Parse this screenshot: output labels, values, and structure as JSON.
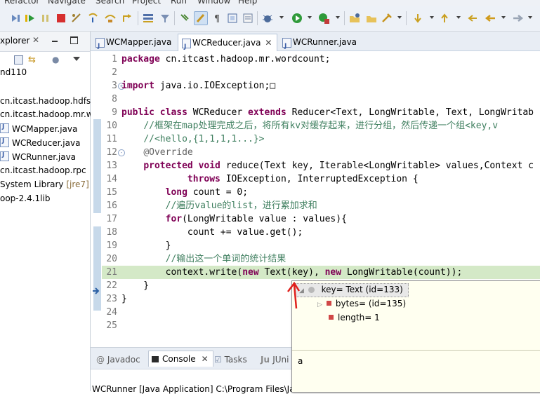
{
  "menu": [
    "Refactor",
    "Navigate",
    "Search",
    "Project",
    "Run",
    "Window",
    "Help"
  ],
  "explorer": {
    "title": "xplorer",
    "items": [
      {
        "label": "nd110",
        "kind": "project"
      },
      {
        "label": "cn.itcast.hadoop.hdfs",
        "kind": "package"
      },
      {
        "label": "cn.itcast.hadoop.mr.w",
        "kind": "package"
      },
      {
        "label": "WCMapper.java",
        "kind": "file"
      },
      {
        "label": "WCReducer.java",
        "kind": "file"
      },
      {
        "label": "WCRunner.java",
        "kind": "file"
      },
      {
        "label": "cn.itcast.hadoop.rpc",
        "kind": "package"
      },
      {
        "label": "System Library",
        "suffix": "[jre7]",
        "kind": "library"
      },
      {
        "label": "oop-2.4.1lib",
        "kind": "library"
      }
    ]
  },
  "editor": {
    "tabs": [
      {
        "label": "WCMapper.java",
        "active": false
      },
      {
        "label": "WCReducer.java",
        "active": true
      },
      {
        "label": "WCRunner.java",
        "active": false
      }
    ],
    "lines": [
      {
        "n": "1",
        "tokens": [
          [
            "kw",
            "package"
          ],
          [
            "t",
            " cn.itcast.hadoop.mr.wordcount;"
          ]
        ]
      },
      {
        "n": "2",
        "tokens": []
      },
      {
        "n": "3",
        "fold": "+",
        "tokens": [
          [
            "kw",
            "import"
          ],
          [
            "t",
            " java.io.IOException;"
          ],
          [
            "t",
            "□"
          ]
        ]
      },
      {
        "n": "8",
        "tokens": []
      },
      {
        "n": "9",
        "tokens": [
          [
            "kw",
            "public class"
          ],
          [
            "t",
            " WCReducer "
          ],
          [
            "kw",
            "extends"
          ],
          [
            "t",
            " Reducer<Text, LongWritable, Text, LongWritab"
          ]
        ]
      },
      {
        "n": "10",
        "tokens": [
          [
            "t",
            "    "
          ],
          [
            "cm",
            "//框架在map处理完成之后，将所有kv对缓存起来，进行分组，然后传递一个组<key,v"
          ]
        ]
      },
      {
        "n": "11",
        "tokens": [
          [
            "t",
            "    "
          ],
          [
            "cm",
            "//<hello,{1,1,1,1...}>"
          ]
        ]
      },
      {
        "n": "12",
        "fold": "-",
        "tokens": [
          [
            "t",
            "    "
          ],
          [
            "an",
            "@Override"
          ]
        ]
      },
      {
        "n": "13",
        "tokens": [
          [
            "t",
            "    "
          ],
          [
            "kw",
            "protected void"
          ],
          [
            "t",
            " reduce(Text key, Iterable<LongWritable> values,Context c"
          ]
        ]
      },
      {
        "n": "14",
        "tokens": [
          [
            "t",
            "            "
          ],
          [
            "kw",
            "throws"
          ],
          [
            "t",
            " IOException, InterruptedException {"
          ]
        ]
      },
      {
        "n": "15",
        "tokens": [
          [
            "t",
            "        "
          ],
          [
            "kw",
            "long"
          ],
          [
            "t",
            " count = 0;"
          ]
        ]
      },
      {
        "n": "16",
        "tokens": [
          [
            "t",
            "        "
          ],
          [
            "cm",
            "//遍历value的list，进行累加求和"
          ]
        ]
      },
      {
        "n": "17",
        "tokens": [
          [
            "t",
            "        "
          ],
          [
            "kw",
            "for"
          ],
          [
            "t",
            "(LongWritable value : values){"
          ]
        ]
      },
      {
        "n": "18",
        "tokens": [
          [
            "t",
            "            count += value.get();"
          ]
        ]
      },
      {
        "n": "19",
        "tokens": [
          [
            "t",
            "        }"
          ]
        ]
      },
      {
        "n": "20",
        "tokens": [
          [
            "t",
            "        "
          ],
          [
            "cm",
            "//输出这一个单词的统计结果"
          ]
        ]
      },
      {
        "n": "21",
        "highlight": true,
        "tokens": [
          [
            "t",
            "        context.write("
          ],
          [
            "kw",
            "new"
          ],
          [
            "t",
            " Text(key), "
          ],
          [
            "kw",
            "new"
          ],
          [
            "t",
            " LongWritable(count));"
          ]
        ]
      },
      {
        "n": "22",
        "tokens": [
          [
            "t",
            "    }"
          ]
        ]
      },
      {
        "n": "23",
        "tokens": [
          [
            "t",
            "}"
          ]
        ]
      },
      {
        "n": "24",
        "tokens": []
      },
      {
        "n": "25",
        "tokens": []
      }
    ]
  },
  "console": {
    "tabs": [
      "Javadoc",
      "Console",
      "Tasks",
      "JUni"
    ],
    "active_tab": "Console",
    "status_line": "WCRunner [Java Application] C:\\Program Files\\Ja"
  },
  "inspect_popup": {
    "root": "key= Text  (id=133)",
    "children": [
      "bytes= (id=135)",
      "length= 1"
    ],
    "detail_value": "a"
  },
  "colors": {
    "keyword": "#7f0055",
    "comment": "#3f7f5f",
    "current_line": "#d4e9c7",
    "toolbar_bg": "#edf1f7",
    "annotation_arrow": "#e0201c"
  }
}
